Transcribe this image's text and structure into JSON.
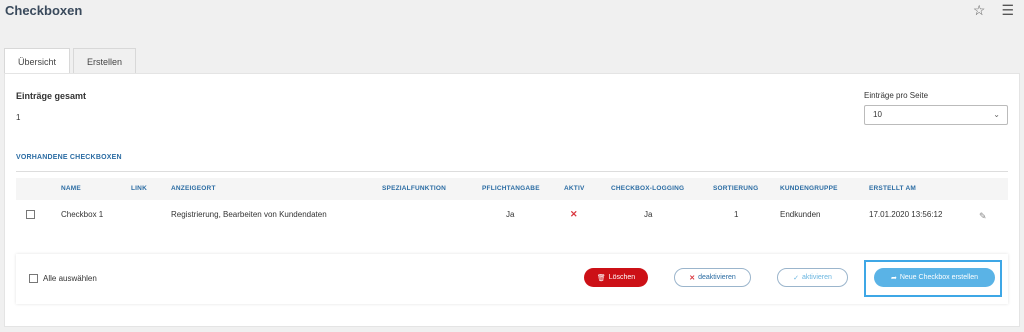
{
  "header": {
    "title": "Checkboxen",
    "icons": [
      "star-icon",
      "settings-panel-icon"
    ]
  },
  "tabs": [
    {
      "label": "Übersicht",
      "active": true
    },
    {
      "label": "Erstellen",
      "active": false
    }
  ],
  "stats": {
    "total_label": "Einträge gesamt",
    "total_value": "1",
    "per_page_label": "Einträge pro Seite",
    "per_page_value": "10"
  },
  "section": {
    "title": "VORHANDENE CHECKBOXEN"
  },
  "table": {
    "columns": [
      "NAME",
      "LINK",
      "ANZEIGEORT",
      "SPEZIALFUNKTION",
      "PFLICHTANGABE",
      "AKTIV",
      "CHECKBOX-LOGGING",
      "SORTIERUNG",
      "KUNDENGRUPPE",
      "ERSTELLT AM"
    ],
    "rows": [
      {
        "name": "Checkbox 1",
        "link": "",
        "anzeigeort": "Registrierung, Bearbeiten von Kundendaten",
        "spezialfunktion": "",
        "pflichtangabe": "Ja",
        "aktiv": "✕",
        "logging": "Ja",
        "sortierung": "1",
        "kundengruppe": "Endkunden",
        "erstellt_am": "17.01.2020 13:56:12"
      }
    ]
  },
  "footer": {
    "select_all_label": "Alle auswählen",
    "delete_label": "Löschen",
    "deactivate_label": "deaktivieren",
    "activate_label": "aktivieren",
    "new_label": "Neue Checkbox erstellen"
  },
  "colors": {
    "accent": "#2b6ca3",
    "danger": "#cc1016",
    "primary_button": "#5ab3e6",
    "highlight_border": "#3ea7e6"
  }
}
